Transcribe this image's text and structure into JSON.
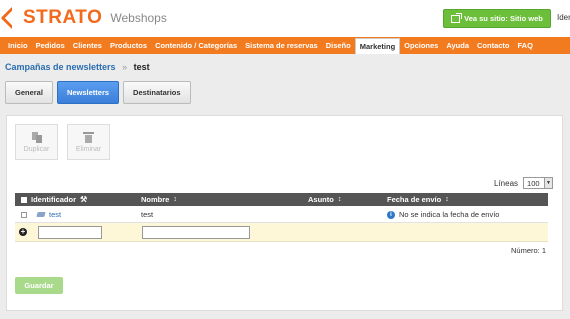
{
  "header": {
    "logo_text": "STRATO",
    "logo_sub": "Webshops",
    "visit_site_label": "Vea su sitio: Sitio web",
    "user_partial": "Iden"
  },
  "nav": {
    "items": [
      "Inicio",
      "Pedidos",
      "Clientes",
      "Productos",
      "Contenido / Categorías",
      "Sistema de reservas",
      "Diseño",
      "Marketing",
      "Opciones",
      "Ayuda",
      "Contacto",
      "FAQ"
    ],
    "active": "Marketing"
  },
  "breadcrumb": {
    "parent": "Campañas de newsletters",
    "separator": "»",
    "current": "test"
  },
  "tabs": [
    "General",
    "Newsletters",
    "Destinatarios"
  ],
  "actions": {
    "duplicate": "Duplicar",
    "delete": "Eliminar"
  },
  "lines": {
    "label": "Líneas",
    "value": "100"
  },
  "grid": {
    "columns": {
      "id": "Identificador",
      "name": "Nombre",
      "subject": "Asunto",
      "send_date": "Fecha de envío"
    },
    "rows": [
      {
        "id": "test",
        "name": "test",
        "subject": "",
        "send_date": "No se indica la fecha de envío"
      }
    ],
    "count_label": "Número: 1"
  },
  "save_label": "Guardar",
  "colors": {
    "brand_orange": "#f37b1f",
    "visit_green": "#6bbf3a",
    "active_tab_blue": "#3a7fd9",
    "link_blue": "#2a6db0"
  }
}
